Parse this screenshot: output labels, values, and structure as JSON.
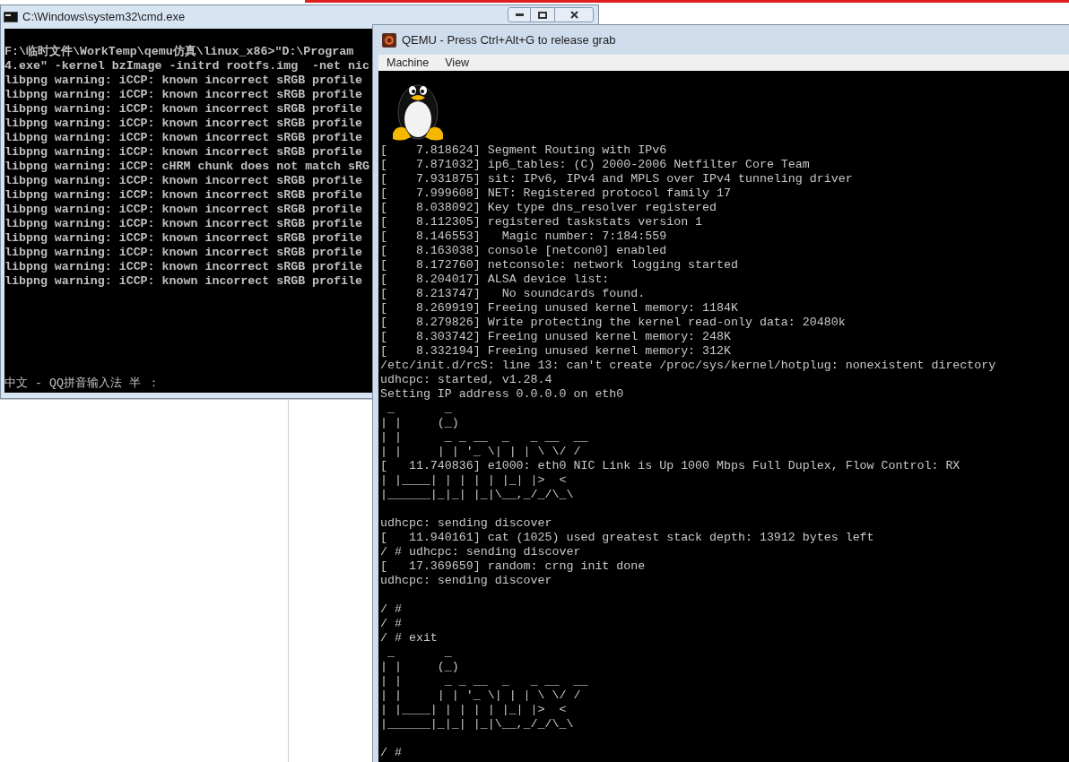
{
  "cmd_window": {
    "title": "C:\\Windows\\system32\\cmd.exe",
    "lines": [
      "F:\\临时文件\\WorkTemp\\qemu仿真\\linux_x86>\"D:\\Program",
      "4.exe\" -kernel bzImage -initrd rootfs.img  -net nic",
      "libpng warning: iCCP: known incorrect sRGB profile",
      "libpng warning: iCCP: known incorrect sRGB profile",
      "libpng warning: iCCP: known incorrect sRGB profile",
      "libpng warning: iCCP: known incorrect sRGB profile",
      "libpng warning: iCCP: known incorrect sRGB profile",
      "libpng warning: iCCP: known incorrect sRGB profile",
      "libpng warning: iCCP: cHRM chunk does not match sRG",
      "libpng warning: iCCP: known incorrect sRGB profile",
      "libpng warning: iCCP: known incorrect sRGB profile",
      "libpng warning: iCCP: known incorrect sRGB profile",
      "libpng warning: iCCP: known incorrect sRGB profile",
      "libpng warning: iCCP: known incorrect sRGB profile",
      "libpng warning: iCCP: known incorrect sRGB profile",
      "libpng warning: iCCP: known incorrect sRGB profile",
      "libpng warning: iCCP: known incorrect sRGB profile"
    ],
    "ime_status": "中文 - QQ拼音输入法 半 ："
  },
  "qemu_window": {
    "title": "QEMU - Press Ctrl+Alt+G to release grab",
    "menu": [
      "Machine",
      "View"
    ],
    "console_blocks": [
      [
        "[    7.818624] Segment Routing with IPv6",
        "[    7.871032] ip6_tables: (C) 2000-2006 Netfilter Core Team",
        "[    7.931875] sit: IPv6, IPv4 and MPLS over IPv4 tunneling driver",
        "[    7.999608] NET: Registered protocol family 17",
        "[    8.038092] Key type dns_resolver registered",
        "[    8.112305] registered taskstats version 1",
        "[    8.146553]   Magic number: 7:184:559",
        "[    8.163038] console [netcon0] enabled",
        "[    8.172760] netconsole: network logging started",
        "[    8.204017] ALSA device list:",
        "[    8.213747]   No soundcards found.",
        "[    8.269919] Freeing unused kernel memory: 1184K",
        "[    8.279826] Write protecting the kernel read-only data: 20480k",
        "[    8.303742] Freeing unused kernel memory: 248K",
        "[    8.332194] Freeing unused kernel memory: 312K",
        "/etc/init.d/rcS: line 13: can't create /proc/sys/kernel/hotplug: nonexistent directory",
        "udhcpc: started, v1.28.4",
        "Setting IP address 0.0.0.0 on eth0",
        " _       _",
        "| |     (_)",
        "| |      _ _ __  _   _ __  __",
        "| |     | | '_ \\| | | \\ \\/ /",
        "[   11.740836] e1000: eth0 NIC Link is Up 1000 Mbps Full Duplex, Flow Control: RX",
        "| |____| | | | | |_| |>  <",
        "|______|_|_| |_|\\__,_/_/\\_\\"
      ],
      [
        "udhcpc: sending discover",
        "[   11.940161] cat (1025) used greatest stack depth: 13912 bytes left",
        "/ # udhcpc: sending discover",
        "[   17.369659] random: crng init done",
        "udhcpc: sending discover"
      ],
      [
        "/ #",
        "/ #",
        "/ # exit",
        " _       _",
        "| |     (_)",
        "| |      _ _ __  _   _ __  __",
        "| |     | | '_ \\| | | \\ \\/ /",
        "| |____| | | | | |_| |>  <",
        "|______|_|_| |_|\\__,_/_/\\_\\"
      ],
      [
        "/ #"
      ]
    ]
  }
}
